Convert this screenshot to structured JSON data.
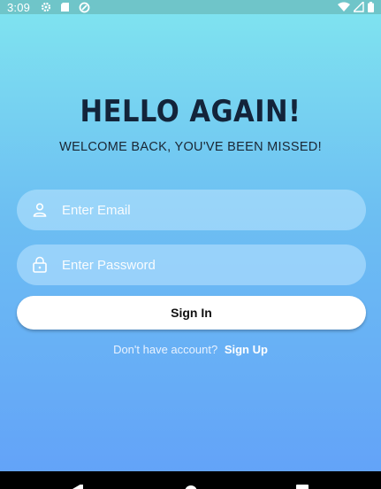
{
  "status_bar": {
    "time": "3:09",
    "left_icons": [
      "gear-icon",
      "sd-card-icon",
      "sync-icon"
    ],
    "right_icons": [
      "wifi-icon",
      "signal-icon",
      "battery-icon"
    ]
  },
  "header": {
    "title": "HELLO AGAIN!",
    "subtitle": "WELCOME BACK, YOU'VE BEEN MISSED!"
  },
  "form": {
    "email": {
      "placeholder": "Enter Email",
      "value": "",
      "icon": "person-icon"
    },
    "password": {
      "placeholder": "Enter Password",
      "value": "",
      "icon": "lock-icon"
    },
    "signin_label": "Sign In",
    "signup_prompt": "Don't have account?",
    "signup_link": "Sign Up"
  },
  "nav_bar": {
    "buttons": [
      "back-icon",
      "home-icon",
      "recents-icon"
    ]
  },
  "colors": {
    "gradient_top": "#80e5f0",
    "gradient_bottom": "#63a3f8",
    "title": "#13243a",
    "field_bg": "rgba(190,230,255,0.55)"
  }
}
